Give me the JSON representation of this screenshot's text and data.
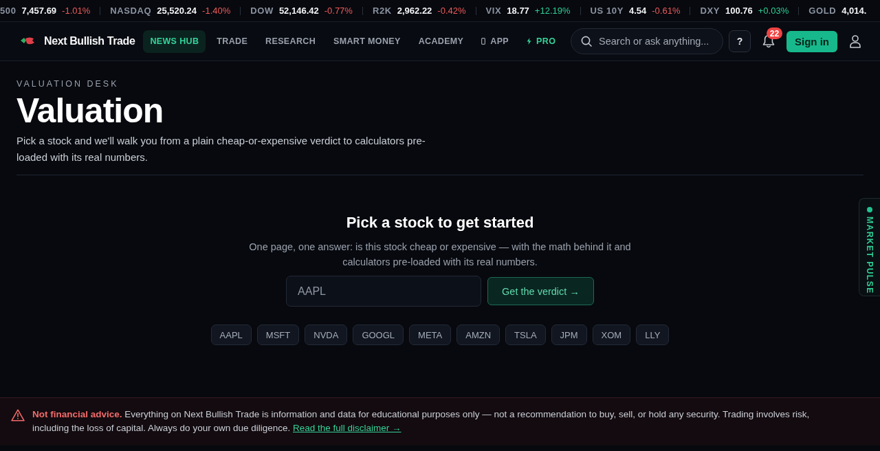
{
  "ticker": [
    {
      "symbol": "500",
      "price": "7,457.69",
      "change": "-1.01%",
      "rising": false
    },
    {
      "symbol": "NASDAQ",
      "price": "25,520.24",
      "change": "-1.40%",
      "rising": false
    },
    {
      "symbol": "DOW",
      "price": "52,146.42",
      "change": "-0.77%",
      "rising": false
    },
    {
      "symbol": "R2K",
      "price": "2,962.22",
      "change": "-0.42%",
      "rising": false
    },
    {
      "symbol": "VIX",
      "price": "18.77",
      "change": "+12.19%",
      "rising": true
    },
    {
      "symbol": "US 10Y",
      "price": "4.54",
      "change": "-0.61%",
      "rising": false
    },
    {
      "symbol": "DXY",
      "price": "100.76",
      "change": "+0.03%",
      "rising": true
    },
    {
      "symbol": "GOLD",
      "price": "4,014."
    }
  ],
  "nav": {
    "brand": "Next Bullish Trade",
    "items": [
      {
        "label": "NEWS HUB",
        "kind": "plain",
        "selected": true
      },
      {
        "label": "TRADE",
        "kind": "plain",
        "selected": false
      },
      {
        "label": "RESEARCH",
        "kind": "plain",
        "selected": false
      },
      {
        "label": "SMART MONEY",
        "kind": "plain",
        "selected": false
      },
      {
        "label": "ACADEMY",
        "kind": "plain",
        "selected": false
      },
      {
        "label": "APP",
        "kind": "app",
        "selected": false
      },
      {
        "label": "PRO",
        "kind": "pro",
        "selected": false
      }
    ],
    "search": {
      "placeholder": "Search or ask anything..."
    },
    "help_button": "?",
    "notifications": {
      "count": "22"
    },
    "sign_in": "Sign in"
  },
  "header": {
    "eyebrow": "VALUATION DESK",
    "title": "Valuation",
    "description": "Pick a stock and we'll walk you from a plain cheap-or-expensive verdict to calculators pre-loaded with its real numbers."
  },
  "picker": {
    "title": "Pick a stock to get started",
    "subtitle": "One page, one answer: is this stock cheap or expensive — with the math behind it and calculators pre-loaded with its real numbers.",
    "input": {
      "placeholder": "AAPL"
    },
    "button": "Get the verdict →",
    "chips": [
      "AAPL",
      "MSFT",
      "NVDA",
      "GOOGL",
      "META",
      "AMZN",
      "TSLA",
      "JPM",
      "XOM",
      "LLY"
    ]
  },
  "side_tab": {
    "label": "MARKET PULSE"
  },
  "disclaimer": {
    "text": "**Not financial advice.** Everything on Next Bullish Trade is information and data for educational purposes only — not a recommendation to buy, sell, or hold any security. Trading involves risk, including the loss of capital. Always do your own due diligence.",
    "link": "Read the full disclaimer →"
  }
}
